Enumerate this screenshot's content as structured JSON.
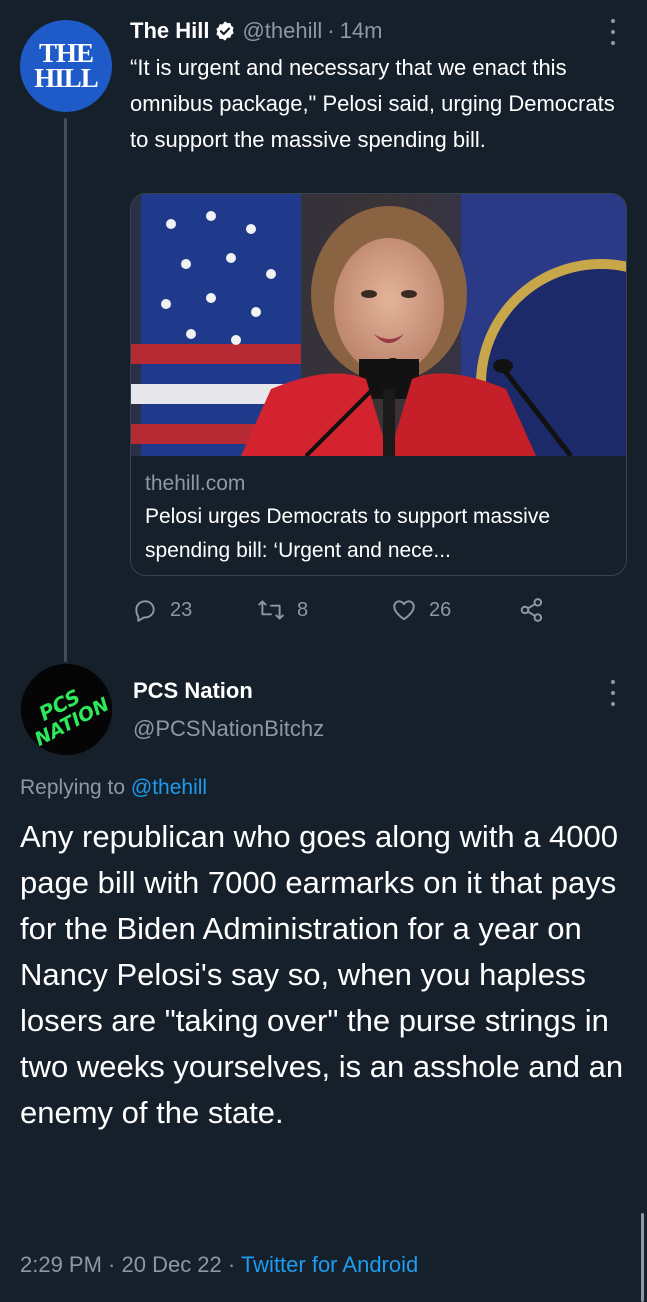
{
  "parent_tweet": {
    "avatar_text": [
      "THE",
      "HILL"
    ],
    "display_name": "The Hill",
    "handle": "@thehill",
    "separator": "·",
    "time": "14m",
    "text": "“It is urgent and necessary that we enact this omnibus package,\" Pelosi said, urging Democrats to support the massive spending bill.",
    "card": {
      "domain": "thehill.com",
      "title": "Pelosi urges Democrats to support massive spending bill: ‘Urgent and nece..."
    },
    "actions": {
      "replies": "23",
      "retweets": "8",
      "likes": "26"
    }
  },
  "reply_tweet": {
    "avatar_text": [
      "PCS",
      "NATION"
    ],
    "display_name": "PCS Nation",
    "handle": "@PCSNationBitchz",
    "replying_prefix": "Replying to",
    "replying_mention": "@thehill",
    "text": "Any republican who goes along with a 4000 page bill with 7000 earmarks on it that pays for the Biden Administration for a year on Nancy Pelosi's say so, when you hapless losers are \"taking over\" the purse strings in two weeks yourselves, is an asshole and an enemy of the state.",
    "timestamp": "2:29 PM · 20 Dec 22 · ",
    "source": "Twitter for Android"
  },
  "colors": {
    "background": "#15202b",
    "secondary_text": "#8b98a5",
    "link": "#1d9bf0",
    "avatar_thehill": "#1e5ac8",
    "pcs_logo_green": "#2ee85a"
  },
  "icons": [
    "verified-badge-icon",
    "more-options-icon",
    "reply-icon",
    "retweet-icon",
    "like-icon",
    "share-icon"
  ]
}
